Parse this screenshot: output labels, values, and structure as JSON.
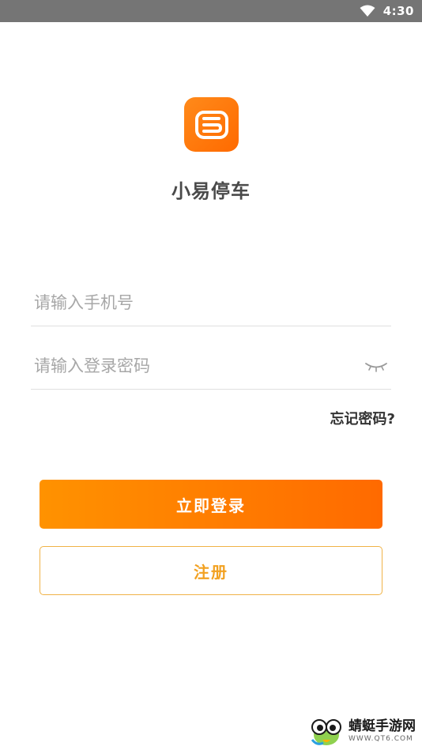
{
  "status_bar": {
    "time": "4:30"
  },
  "app": {
    "name": "小易停车"
  },
  "form": {
    "phone_placeholder": "请输入手机号",
    "password_placeholder": "请输入登录密码",
    "forgot_label": "忘记密码?"
  },
  "buttons": {
    "login_label": "立即登录",
    "register_label": "注册"
  },
  "watermark": {
    "title": "蜻蜓手游网",
    "url": "WWW.QT6.COM"
  },
  "colors": {
    "accent": "#ff7a00",
    "register_text": "#f2a121",
    "register_border": "#f0b347"
  }
}
